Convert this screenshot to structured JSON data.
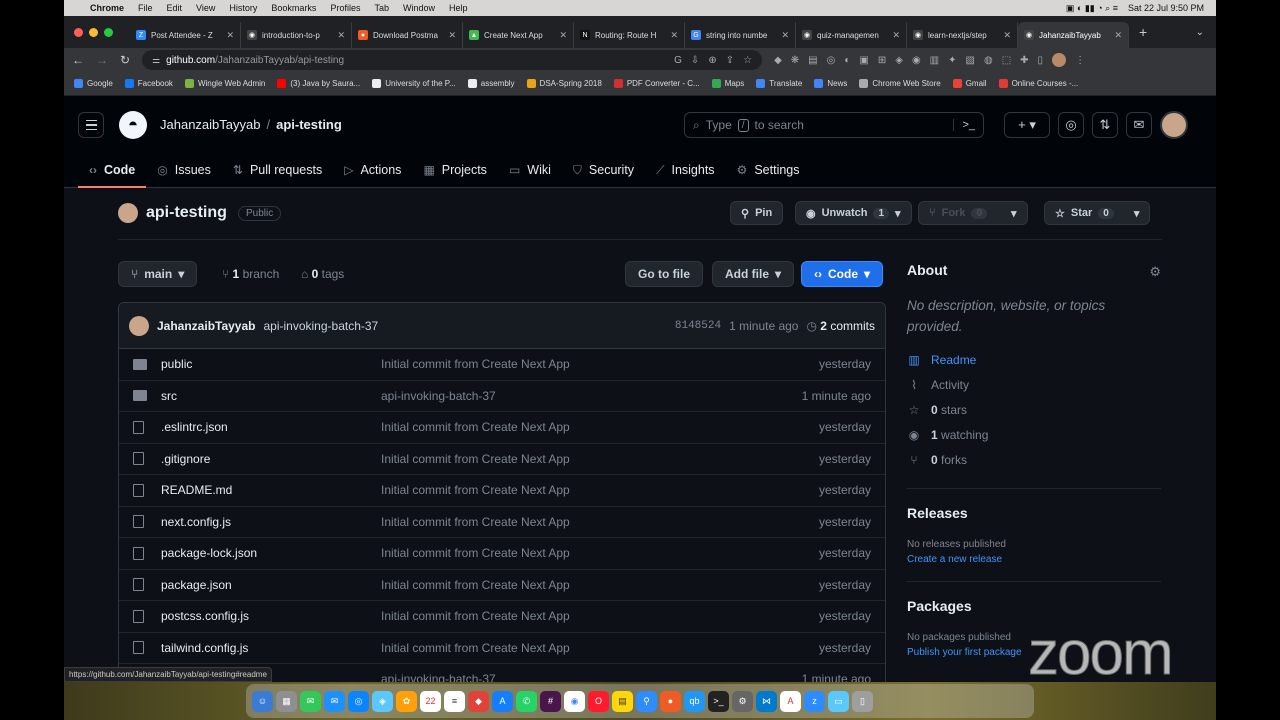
{
  "macos": {
    "menu": [
      "Chrome",
      "File",
      "Edit",
      "View",
      "History",
      "Bookmarks",
      "Profiles",
      "Tab",
      "Window",
      "Help"
    ],
    "clock": "Sat 22 Jul  9:50 PM"
  },
  "tabs": [
    {
      "label": "Post Attendee - Z",
      "color": "#2d8cff",
      "glyph": "Z"
    },
    {
      "label": "introduction-to-p",
      "color": "#444",
      "glyph": "◉"
    },
    {
      "label": "Download Postma",
      "color": "#ef5b25",
      "glyph": "●"
    },
    {
      "label": "Create Next App",
      "color": "#3fb950",
      "glyph": "▲"
    },
    {
      "label": "Routing: Route H",
      "color": "#111",
      "glyph": "N"
    },
    {
      "label": "string into numbe",
      "color": "#4285f4",
      "glyph": "G"
    },
    {
      "label": "quiz-managemen",
      "color": "#444",
      "glyph": "◉"
    },
    {
      "label": "learn-nextjs/step",
      "color": "#444",
      "glyph": "◉"
    },
    {
      "label": "JahanzaibTayyab",
      "color": "#444",
      "glyph": "◉",
      "active": true
    }
  ],
  "address": {
    "host": "github.com",
    "path": "/JahanzaibTayyab/api-testing"
  },
  "bookmarks": [
    {
      "label": "Google",
      "color": "#4285f4"
    },
    {
      "label": "Facebook",
      "color": "#1877f2"
    },
    {
      "label": "Wingle Web Admin",
      "color": "#7cb342"
    },
    {
      "label": "(3) Java by Saura...",
      "color": "#ff0000"
    },
    {
      "label": "University of the P...",
      "color": "#eee"
    },
    {
      "label": "assembly",
      "color": "#eee"
    },
    {
      "label": "DSA-Spring 2018",
      "color": "#e8a317"
    },
    {
      "label": "PDF Converter - C...",
      "color": "#d32f2f"
    },
    {
      "label": "Maps",
      "color": "#34a853"
    },
    {
      "label": "Translate",
      "color": "#4285f4"
    },
    {
      "label": "News",
      "color": "#4285f4"
    },
    {
      "label": "Chrome Web Store",
      "color": "#aaa"
    },
    {
      "label": "Gmail",
      "color": "#ea4335"
    },
    {
      "label": "Online Courses -...",
      "color": "#e53935"
    }
  ],
  "github": {
    "owner": "JahanzaibTayyab",
    "repo": "api-testing",
    "search_placeholder_a": "Type",
    "search_key": "/",
    "search_placeholder_b": "to search",
    "nav": [
      {
        "label": "Code",
        "icon": "‹›",
        "selected": true
      },
      {
        "label": "Issues",
        "icon": "◎"
      },
      {
        "label": "Pull requests",
        "icon": "⇅"
      },
      {
        "label": "Actions",
        "icon": "▷"
      },
      {
        "label": "Projects",
        "icon": "▦"
      },
      {
        "label": "Wiki",
        "icon": "▭"
      },
      {
        "label": "Security",
        "icon": "⛉"
      },
      {
        "label": "Insights",
        "icon": "⟋"
      },
      {
        "label": "Settings",
        "icon": "⚙"
      }
    ],
    "visibility": "Public",
    "pin": "Pin",
    "unwatch": "Unwatch",
    "unwatch_count": "1",
    "fork": "Fork",
    "fork_count": "0",
    "star": "Star",
    "star_count": "0",
    "branch": "main",
    "branches_count": "1",
    "branches_label": "branch",
    "tags_count": "0",
    "tags_label": "tags",
    "goto_file": "Go to file",
    "add_file": "Add file",
    "code_btn": "Code",
    "last_commit": {
      "user": "JahanzaibTayyab",
      "message": "api-invoking-batch-37",
      "sha": "8148524",
      "time": "1 minute ago",
      "commits_count": "2",
      "commits_label": "commits"
    },
    "files": [
      {
        "name": "public",
        "type": "folder",
        "commit": "Initial commit from Create Next App",
        "time": "yesterday"
      },
      {
        "name": "src",
        "type": "folder",
        "commit": "api-invoking-batch-37",
        "time": "1 minute ago"
      },
      {
        "name": ".eslintrc.json",
        "type": "file",
        "commit": "Initial commit from Create Next App",
        "time": "yesterday"
      },
      {
        "name": ".gitignore",
        "type": "file",
        "commit": "Initial commit from Create Next App",
        "time": "yesterday"
      },
      {
        "name": "README.md",
        "type": "file",
        "commit": "Initial commit from Create Next App",
        "time": "yesterday"
      },
      {
        "name": "next.config.js",
        "type": "file",
        "commit": "Initial commit from Create Next App",
        "time": "yesterday"
      },
      {
        "name": "package-lock.json",
        "type": "file",
        "commit": "Initial commit from Create Next App",
        "time": "yesterday"
      },
      {
        "name": "package.json",
        "type": "file",
        "commit": "Initial commit from Create Next App",
        "time": "yesterday"
      },
      {
        "name": "postcss.config.js",
        "type": "file",
        "commit": "Initial commit from Create Next App",
        "time": "yesterday"
      },
      {
        "name": "tailwind.config.js",
        "type": "file",
        "commit": "Initial commit from Create Next App",
        "time": "yesterday"
      },
      {
        "name": "",
        "type": "file",
        "commit": "api-invoking-batch-37",
        "time": "1 minute ago"
      }
    ],
    "about": {
      "title": "About",
      "description": "No description, website, or topics provided.",
      "readme": "Readme",
      "activity": "Activity",
      "stars": "0",
      "stars_label": "stars",
      "watching": "1",
      "watching_label": "watching",
      "forks": "0",
      "forks_label": "forks"
    },
    "releases": {
      "title": "Releases",
      "empty": "No releases published",
      "link": "Create a new release"
    },
    "packages": {
      "title": "Packages",
      "empty": "No packages published",
      "link": "Publish your first package"
    }
  },
  "status_url": "https://github.com/JahanzaibTayyab/api-testing#readme",
  "watermark": "zoom"
}
